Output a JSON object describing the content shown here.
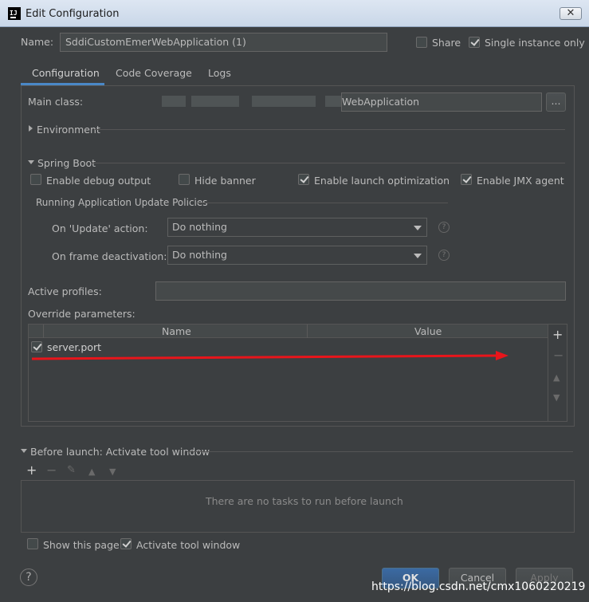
{
  "window": {
    "title": "Edit Configuration",
    "close_label": "✕"
  },
  "name_row": {
    "label": "Name:",
    "value": "SddiCustomEmerWebApplication (1)",
    "share_label": "Share",
    "share_checked": false,
    "single_instance_label": "Single instance only",
    "single_instance_checked": true
  },
  "tabs": [
    {
      "label": "Configuration",
      "active": true
    },
    {
      "label": "Code Coverage",
      "active": false
    },
    {
      "label": "Logs",
      "active": false
    }
  ],
  "main_class": {
    "label": "Main class:",
    "value": "WebApplication",
    "browse_label": "..."
  },
  "environment": {
    "label": "Environment"
  },
  "spring_boot": {
    "label": "Spring Boot",
    "enable_debug_output": {
      "label": "Enable debug output",
      "checked": false
    },
    "hide_banner": {
      "label": "Hide banner",
      "checked": false
    },
    "enable_launch_optimization": {
      "label": "Enable launch optimization",
      "checked": true
    },
    "enable_jmx_agent": {
      "label": "Enable JMX agent",
      "checked": true
    }
  },
  "update_policies": {
    "label": "Running Application Update Policies",
    "on_update_label": "On 'Update' action:",
    "on_update_value": "Do nothing",
    "on_frame_label": "On frame deactivation:",
    "on_frame_value": "Do nothing",
    "help_glyph": "?"
  },
  "active_profiles": {
    "label": "Active profiles:",
    "value": ""
  },
  "override_params": {
    "label": "Override parameters:",
    "columns": [
      "Name",
      "Value"
    ],
    "rows": [
      {
        "name": "server.port",
        "value": "",
        "checked": true
      }
    ],
    "buttons": {
      "add": "+",
      "remove": "−",
      "up": "▲",
      "down": "▼"
    }
  },
  "before_launch": {
    "label": "Before launch: Activate tool window",
    "empty_text": "There are no tasks to run before launch",
    "toolbar": {
      "add": "+",
      "remove": "−",
      "edit": "✎",
      "up": "▲",
      "down": "▼"
    }
  },
  "footer": {
    "show_this_page": {
      "label": "Show this page",
      "checked": false
    },
    "activate_tool_window": {
      "label": "Activate tool window",
      "checked": true
    },
    "help_glyph": "?",
    "ok_label": "OK",
    "cancel_label": "Cancel",
    "apply_label": "Apply",
    "watermark": "https://blog.csdn.net/cmx1060220219"
  },
  "colors": {
    "background": "#3c3f41",
    "accent": "#4a88c7",
    "arrow": "#e8151b"
  }
}
